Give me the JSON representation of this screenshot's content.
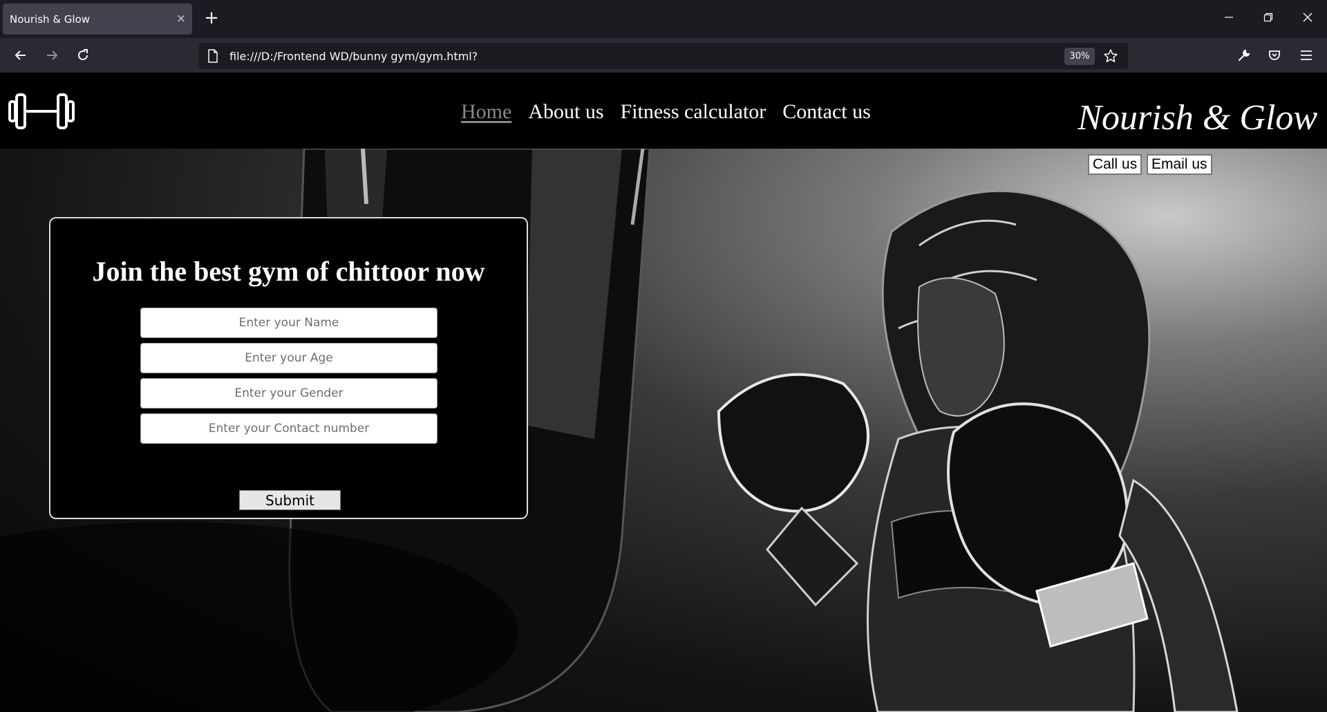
{
  "browser": {
    "tab_title": "Nourish & Glow",
    "tab_close": "×",
    "new_tab": "+",
    "url": "file:///D:/Frontend WD/bunny gym/gym.html?",
    "zoom": "30%"
  },
  "site": {
    "brand": "Nourish & Glow",
    "nav": [
      {
        "label": "Home",
        "active": true
      },
      {
        "label": "About us"
      },
      {
        "label": "Fitness calculator"
      },
      {
        "label": "Contact us"
      }
    ],
    "buttons": {
      "call": "Call us",
      "email": "Email us"
    }
  },
  "form": {
    "heading": "Join the best gym of chittoor now",
    "fields": [
      {
        "placeholder": "Enter your Name"
      },
      {
        "placeholder": "Enter your Age"
      },
      {
        "placeholder": "Enter your Gender"
      },
      {
        "placeholder": "Enter your Contact number"
      }
    ],
    "submit": "Submit"
  }
}
